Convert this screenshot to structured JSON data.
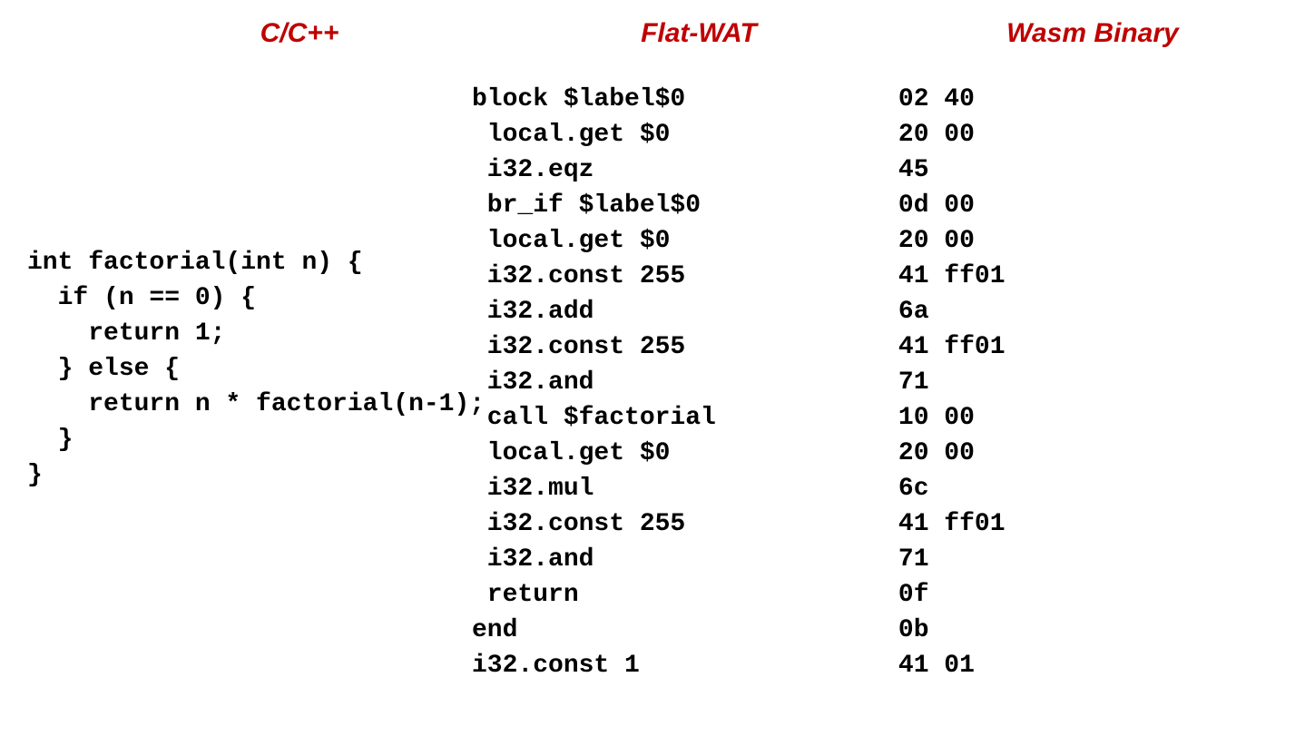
{
  "headers": {
    "c": "C/C++",
    "wat": "Flat-WAT",
    "bin": "Wasm Binary"
  },
  "c_code": "int factorial(int n) {\n  if (n == 0) {\n    return 1;\n  } else {\n    return n * factorial(n-1);\n  }\n}",
  "wat_code": "block $label$0\n local.get $0\n i32.eqz\n br_if $label$0\n local.get $0\n i32.const 255\n i32.add\n i32.const 255\n i32.and\n call $factorial\n local.get $0\n i32.mul\n i32.const 255\n i32.and\n return\nend\ni32.const 1",
  "bin_code": "02 40\n20 00\n45\n0d 00\n20 00\n41 ff01\n6a\n41 ff01\n71\n10 00\n20 00\n6c\n41 ff01\n71\n0f\n0b\n41 01"
}
